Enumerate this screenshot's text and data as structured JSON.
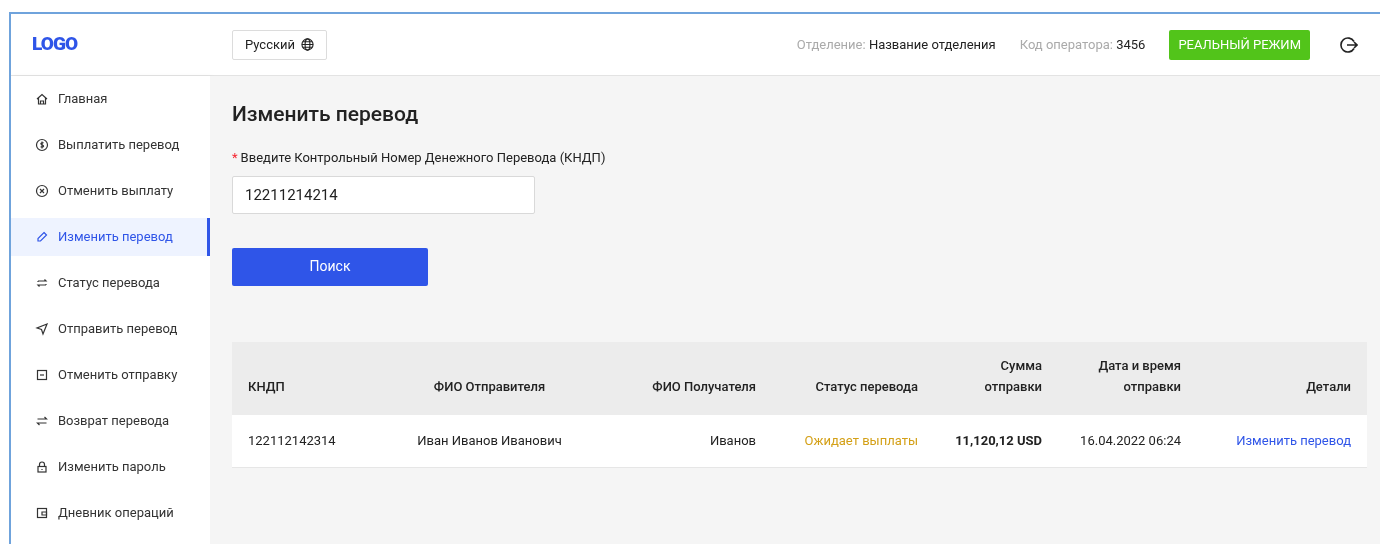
{
  "header": {
    "logo": "LOGO",
    "language": "Русский",
    "branch_label": "Отделение:",
    "branch_value": "Название отделения",
    "operator_label": "Код оператора:",
    "operator_value": "3456",
    "mode_badge": "РЕАЛЬНЫЙ РЕЖИМ"
  },
  "sidebar": {
    "items": [
      {
        "label": "Главная",
        "selected": false
      },
      {
        "label": "Выплатить перевод",
        "selected": false
      },
      {
        "label": "Отменить выплату",
        "selected": false
      },
      {
        "label": "Изменить перевод",
        "selected": true
      },
      {
        "label": "Статус перевода",
        "selected": false
      },
      {
        "label": "Отправить перевод",
        "selected": false
      },
      {
        "label": "Отменить отправку",
        "selected": false
      },
      {
        "label": "Возврат перевода",
        "selected": false
      },
      {
        "label": "Изменить пароль",
        "selected": false
      },
      {
        "label": "Дневник операций",
        "selected": false
      }
    ]
  },
  "main": {
    "title": "Изменить перевод",
    "required_mark": "*",
    "field_label": "Введите Контрольный Номер Денежного Перевода (КНДП)",
    "field_value": "12211214214",
    "search_button": "Поиск"
  },
  "table": {
    "columns": [
      "КНДП",
      "ФИО Отправителя",
      "ФИО Получателя",
      "Статус перевода",
      "Сумма отправки",
      "Дата и время отправки",
      "Детали"
    ],
    "rows": [
      {
        "cells": [
          {
            "text": "122112142314",
            "kind": "plain"
          },
          {
            "text": "Иван Иванов Иванович",
            "kind": "plain"
          },
          {
            "text": "Иванов",
            "kind": "plain"
          },
          {
            "text": "Ожидает выплаты",
            "kind": "status"
          },
          {
            "text": "11,120,12 USD",
            "kind": "amount"
          },
          {
            "text": "16.04.2022 06:24",
            "kind": "plain"
          },
          {
            "text": "Изменить перевод",
            "kind": "link"
          }
        ]
      }
    ]
  }
}
